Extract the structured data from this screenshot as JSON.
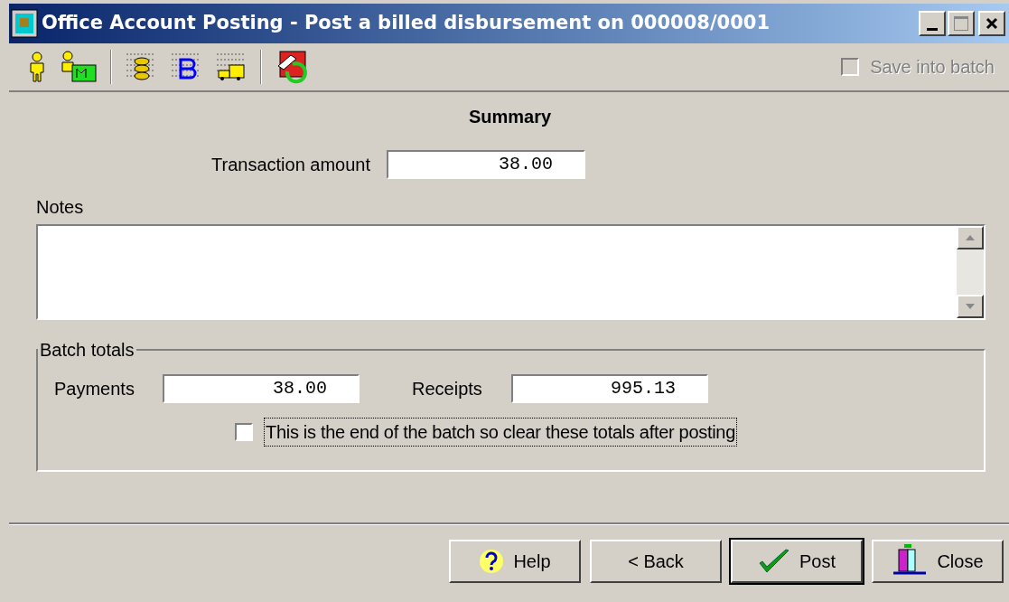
{
  "window": {
    "title": "Office Account Posting - Post a billed disbursement on 000008/0001"
  },
  "toolbar": {
    "save_into_batch": {
      "label": "Save into batch",
      "checked": false,
      "disabled": true
    }
  },
  "summary": {
    "heading": "Summary",
    "transaction_amount": {
      "label": "Transaction amount",
      "value": "38.00"
    },
    "notes": {
      "label": "Notes"
    }
  },
  "batch_totals": {
    "title": "Batch totals",
    "payments": {
      "label": "Payments",
      "value": "38.00"
    },
    "receipts": {
      "label": "Receipts",
      "value": "995.13"
    },
    "clear_after_posting": {
      "label": "This is the end of the batch so clear these totals after posting",
      "checked": false
    }
  },
  "buttons": [
    {
      "kind": "help",
      "label": "Help",
      "default": false
    },
    {
      "kind": "back",
      "label": "< Back",
      "default": false
    },
    {
      "kind": "post",
      "label": "Post",
      "default": true
    },
    {
      "kind": "close",
      "label": "Close",
      "default": false
    }
  ]
}
